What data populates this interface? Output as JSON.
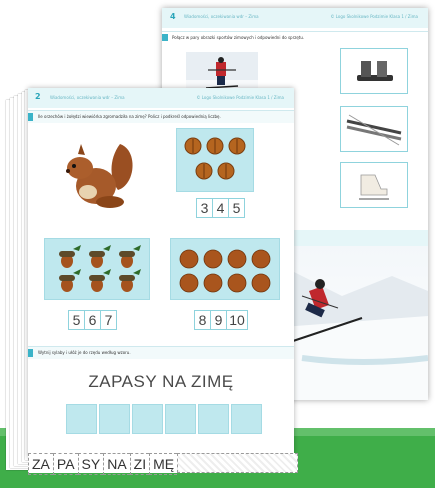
{
  "back_page": {
    "number": "4",
    "header_text": "Wiadomości, oczekiwania wdr – Zima",
    "header_right": "© Logo Skolnikowe Podzimie Klasa 1 / Zima",
    "instruction": "Połącz w pary obrazki sportów zimowych i odpowiedni do sprzętu."
  },
  "front_page": {
    "number": "2",
    "header_text": "Wiadomości, oczekiwania wdr – Zima",
    "header_right": "© Logo Skolnikowe Podzimie Klasa 1 / Zima",
    "instruction_1": "Ile orzechów i żołędzi wiewiórka zgromadziła na zimę? Policz i podkreśl odpowiednią liczbę.",
    "groups": [
      {
        "numbers": [
          "3",
          "4",
          "5"
        ]
      },
      {
        "numbers": [
          "5",
          "6",
          "7"
        ]
      },
      {
        "numbers": [
          "8",
          "9",
          "10"
        ]
      }
    ],
    "instruction_2": "Wytnij sylaby i ułóż je do rzędu według wzoru.",
    "title": "ZAPASY NA ZIMĘ",
    "syllables": [
      "ZA",
      "PA",
      "SY",
      "NA",
      "ZI",
      "MĘ"
    ]
  },
  "colors": {
    "accent": "#3bb3c8",
    "box_fill": "#bfe8ee",
    "green_band": "#3fae49"
  }
}
